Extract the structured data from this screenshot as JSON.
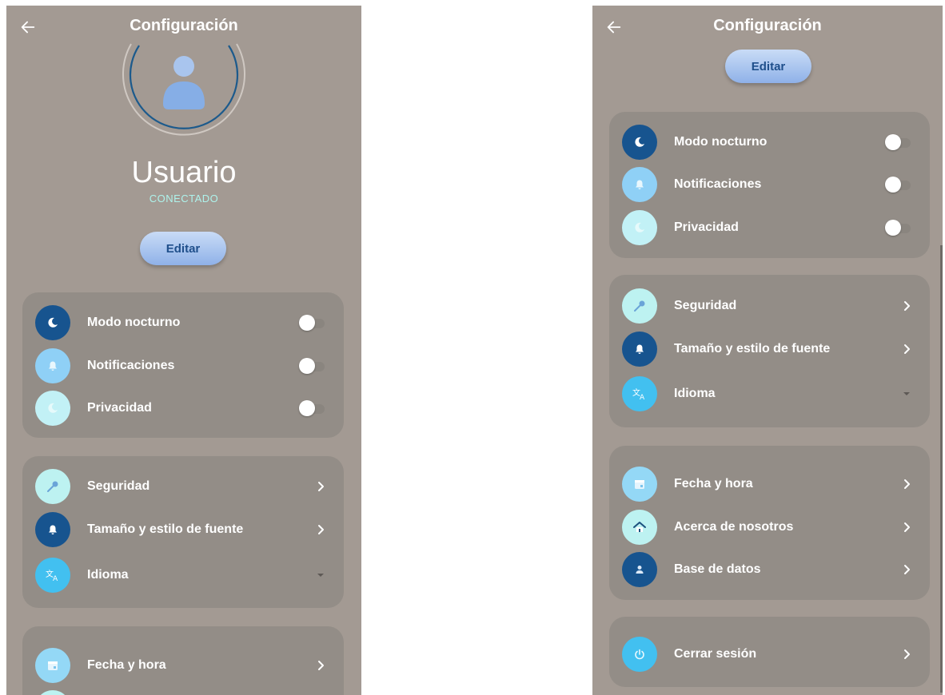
{
  "left": {
    "title": "Configuración",
    "username": "Usuario",
    "status": "CONECTADO",
    "edit_label": "Editar",
    "toggles": [
      {
        "label": "Modo nocturno",
        "icon": "moon-icon"
      },
      {
        "label": "Notificaciones",
        "icon": "bell-icon"
      },
      {
        "label": "Privacidad",
        "icon": "moon-icon"
      }
    ],
    "settings": [
      {
        "label": "Seguridad",
        "icon": "key-icon"
      },
      {
        "label": "Tamaño y estilo de fuente",
        "icon": "bell-icon"
      },
      {
        "label": "Idioma",
        "icon": "translate-icon"
      }
    ],
    "extra": [
      {
        "label": "Fecha y hora",
        "icon": "calendar-icon"
      }
    ]
  },
  "right": {
    "title": "Configuración",
    "edit_label": "Editar",
    "toggles": [
      {
        "label": "Modo nocturno",
        "icon": "moon-icon"
      },
      {
        "label": "Notificaciones",
        "icon": "bell-icon"
      },
      {
        "label": "Privacidad",
        "icon": "moon-icon"
      }
    ],
    "settings": [
      {
        "label": "Seguridad",
        "icon": "key-icon"
      },
      {
        "label": "Tamaño y estilo de fuente",
        "icon": "bell-icon"
      },
      {
        "label": "Idioma",
        "icon": "translate-icon"
      }
    ],
    "extra": [
      {
        "label": "Fecha y hora",
        "icon": "calendar-icon"
      },
      {
        "label": "Acerca de nosotros",
        "icon": "home-icon"
      },
      {
        "label": "Base de datos",
        "icon": "person-icon"
      }
    ],
    "logout": {
      "label": "Cerrar sesión",
      "icon": "power-icon"
    }
  },
  "colors": {
    "background": "#a39a93",
    "card": "#938d87",
    "accent_dark": "#17548f",
    "status_text": "#aef3ec",
    "edit_text": "#1f4f8b"
  }
}
